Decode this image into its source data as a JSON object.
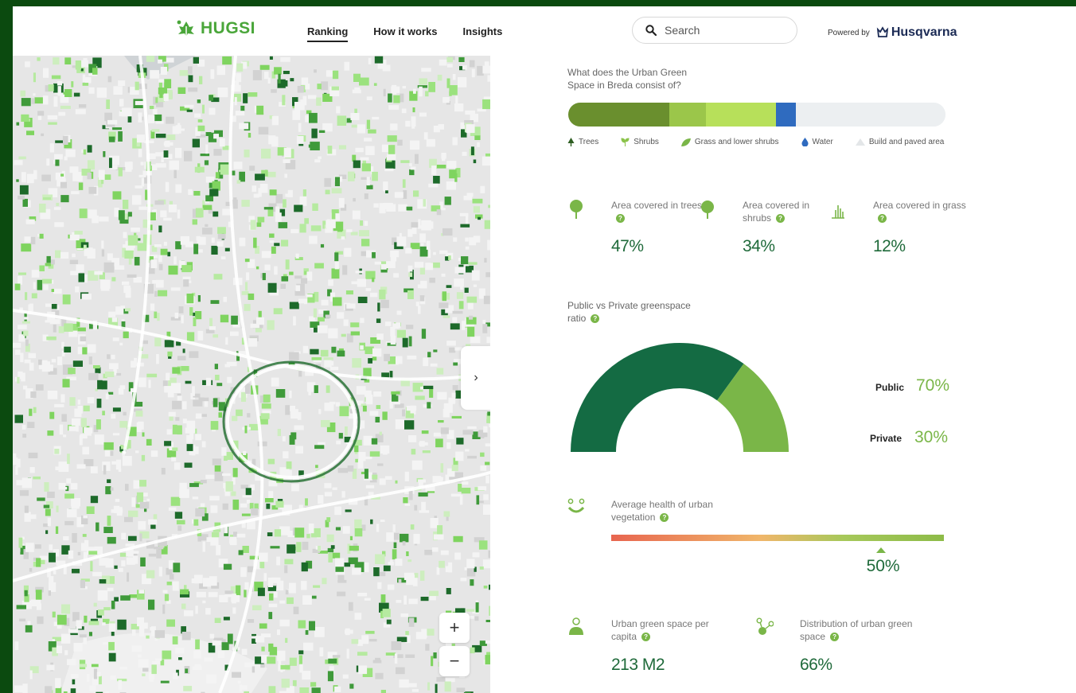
{
  "header": {
    "logo_text": "HUGSI",
    "nav": [
      {
        "label": "Ranking",
        "active": true
      },
      {
        "label": "How it works",
        "active": false
      },
      {
        "label": "Insights",
        "active": false
      }
    ],
    "search_placeholder": "Search",
    "powered_by": "Powered by",
    "brand": "Husqvarna"
  },
  "map": {
    "zoom_in": "+",
    "zoom_out": "−",
    "toggle_panel": "›"
  },
  "composition": {
    "question": "What does the Urban Green Space in Breda consist of?",
    "legend": [
      {
        "label": "Trees",
        "color": "#6a8f2e",
        "icon": "tree-icon"
      },
      {
        "label": "Shrubs",
        "color": "#9bc64a",
        "icon": "sprout-icon"
      },
      {
        "label": "Grass and lower shrubs",
        "color": "#b7e05a",
        "icon": "leaf-icon"
      },
      {
        "label": "Water",
        "color": "#2f6bbf",
        "icon": "drop-icon"
      },
      {
        "label": "Build and paved area",
        "color": "#e3e6e8",
        "icon": "triangle-icon"
      }
    ]
  },
  "stats": {
    "trees": {
      "label": "Area covered in trees",
      "value": "47%"
    },
    "shrubs": {
      "label": "Area covered in shrubs",
      "value": "34%"
    },
    "grass": {
      "label": "Area covered in grass",
      "value": "12%"
    }
  },
  "ratio": {
    "title": "Public vs Private greenspace ratio",
    "public_label": "Public",
    "public_value": "70%",
    "private_label": "Private",
    "private_value": "30%",
    "public_fraction": 0.7,
    "colors": {
      "public": "#146b43",
      "private": "#7ab648"
    }
  },
  "health": {
    "title": "Average health of urban vegetation",
    "value": "50%",
    "level": 0.81
  },
  "per_capita": {
    "label": "Urban green space per capita",
    "value": "213 M2"
  },
  "distribution": {
    "label": "Distribution of urban green space",
    "value": "66%"
  },
  "help_mark": "?"
}
